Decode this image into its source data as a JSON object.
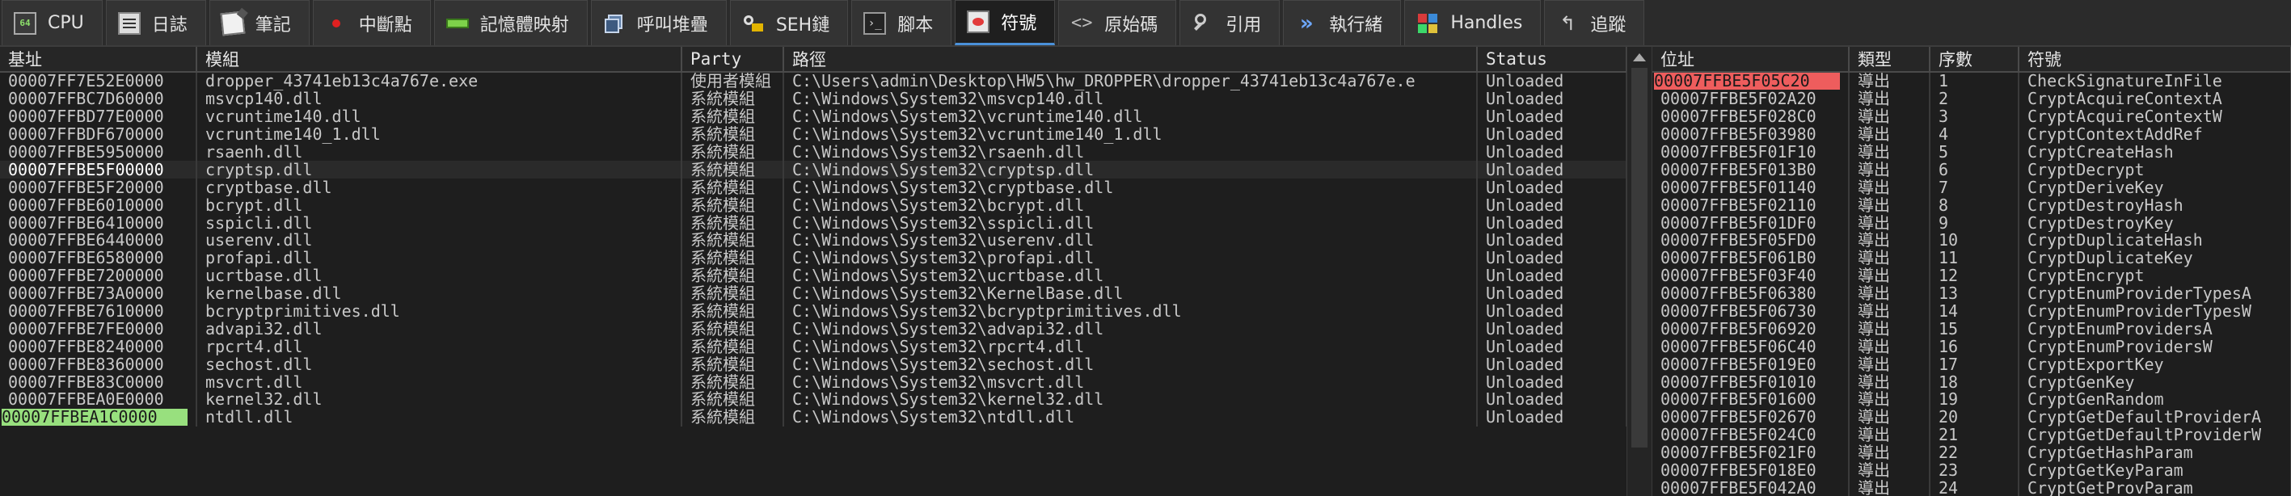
{
  "tabs": [
    {
      "label": "CPU",
      "icon": "cpu-icon"
    },
    {
      "label": "日誌",
      "icon": "log-icon"
    },
    {
      "label": "筆記",
      "icon": "notes-icon"
    },
    {
      "label": "中斷點",
      "icon": "breakpoint-icon"
    },
    {
      "label": "記憶體映射",
      "icon": "memory-map-icon"
    },
    {
      "label": "呼叫堆疊",
      "icon": "call-stack-icon"
    },
    {
      "label": "SEH鏈",
      "icon": "seh-chain-icon"
    },
    {
      "label": "腳本",
      "icon": "script-icon"
    },
    {
      "label": "符號",
      "icon": "symbols-icon",
      "active": true
    },
    {
      "label": "原始碼",
      "icon": "source-icon"
    },
    {
      "label": "引用",
      "icon": "references-icon"
    },
    {
      "label": "執行緒",
      "icon": "threads-icon"
    },
    {
      "label": "Handles",
      "icon": "handles-icon"
    },
    {
      "label": "追蹤",
      "icon": "trace-icon"
    }
  ],
  "modules": {
    "headers": {
      "base": "基址",
      "module": "模組",
      "party": "Party",
      "path": "路徑",
      "status": "Status"
    },
    "rows": [
      {
        "base": "00007FF7E52E0000",
        "module": "dropper_43741eb13c4a767e.exe",
        "party": "使用者模組",
        "path": "C:\\Users\\admin\\Desktop\\HW5\\hw_DROPPER\\dropper_43741eb13c4a767e.e",
        "status": "Unloaded"
      },
      {
        "base": "00007FFBC7D60000",
        "module": "msvcp140.dll",
        "party": "系統模組",
        "path": "C:\\Windows\\System32\\msvcp140.dll",
        "status": "Unloaded"
      },
      {
        "base": "00007FFBD77E0000",
        "module": "vcruntime140.dll",
        "party": "系統模組",
        "path": "C:\\Windows\\System32\\vcruntime140.dll",
        "status": "Unloaded"
      },
      {
        "base": "00007FFBDF670000",
        "module": "vcruntime140_1.dll",
        "party": "系統模組",
        "path": "C:\\Windows\\System32\\vcruntime140_1.dll",
        "status": "Unloaded"
      },
      {
        "base": "00007FFBE5950000",
        "module": "rsaenh.dll",
        "party": "系統模組",
        "path": "C:\\Windows\\System32\\rsaenh.dll",
        "status": "Unloaded"
      },
      {
        "base": "00007FFBE5F00000",
        "module": "cryptsp.dll",
        "party": "系統模組",
        "path": "C:\\Windows\\System32\\cryptsp.dll",
        "status": "Unloaded",
        "selected": true
      },
      {
        "base": "00007FFBE5F20000",
        "module": "cryptbase.dll",
        "party": "系統模組",
        "path": "C:\\Windows\\System32\\cryptbase.dll",
        "status": "Unloaded"
      },
      {
        "base": "00007FFBE6010000",
        "module": "bcrypt.dll",
        "party": "系統模組",
        "path": "C:\\Windows\\System32\\bcrypt.dll",
        "status": "Unloaded"
      },
      {
        "base": "00007FFBE6410000",
        "module": "sspicli.dll",
        "party": "系統模組",
        "path": "C:\\Windows\\System32\\sspicli.dll",
        "status": "Unloaded"
      },
      {
        "base": "00007FFBE6440000",
        "module": "userenv.dll",
        "party": "系統模組",
        "path": "C:\\Windows\\System32\\userenv.dll",
        "status": "Unloaded"
      },
      {
        "base": "00007FFBE6580000",
        "module": "profapi.dll",
        "party": "系統模組",
        "path": "C:\\Windows\\System32\\profapi.dll",
        "status": "Unloaded"
      },
      {
        "base": "00007FFBE7200000",
        "module": "ucrtbase.dll",
        "party": "系統模組",
        "path": "C:\\Windows\\System32\\ucrtbase.dll",
        "status": "Unloaded"
      },
      {
        "base": "00007FFBE73A0000",
        "module": "kernelbase.dll",
        "party": "系統模組",
        "path": "C:\\Windows\\System32\\KernelBase.dll",
        "status": "Unloaded"
      },
      {
        "base": "00007FFBE7610000",
        "module": "bcryptprimitives.dll",
        "party": "系統模組",
        "path": "C:\\Windows\\System32\\bcryptprimitives.dll",
        "status": "Unloaded"
      },
      {
        "base": "00007FFBE7FE0000",
        "module": "advapi32.dll",
        "party": "系統模組",
        "path": "C:\\Windows\\System32\\advapi32.dll",
        "status": "Unloaded"
      },
      {
        "base": "00007FFBE8240000",
        "module": "rpcrt4.dll",
        "party": "系統模組",
        "path": "C:\\Windows\\System32\\rpcrt4.dll",
        "status": "Unloaded"
      },
      {
        "base": "00007FFBE8360000",
        "module": "sechost.dll",
        "party": "系統模組",
        "path": "C:\\Windows\\System32\\sechost.dll",
        "status": "Unloaded"
      },
      {
        "base": "00007FFBE83C0000",
        "module": "msvcrt.dll",
        "party": "系統模組",
        "path": "C:\\Windows\\System32\\msvcrt.dll",
        "status": "Unloaded"
      },
      {
        "base": "00007FFBEA0E0000",
        "module": "kernel32.dll",
        "party": "系統模組",
        "path": "C:\\Windows\\System32\\kernel32.dll",
        "status": "Unloaded"
      },
      {
        "base": "00007FFBEA1C0000",
        "module": "ntdll.dll",
        "party": "系統模組",
        "path": "C:\\Windows\\System32\\ntdll.dll",
        "status": "Unloaded",
        "highlight": true
      }
    ]
  },
  "symbols": {
    "headers": {
      "address": "位址",
      "type": "類型",
      "ordinal": "序數",
      "symbol": "符號"
    },
    "rows": [
      {
        "address": "00007FFBE5F05C20",
        "type": "導出",
        "ordinal": "1",
        "symbol": "CheckSignatureInFile",
        "highlight": true
      },
      {
        "address": "00007FFBE5F02A20",
        "type": "導出",
        "ordinal": "2",
        "symbol": "CryptAcquireContextA"
      },
      {
        "address": "00007FFBE5F028C0",
        "type": "導出",
        "ordinal": "3",
        "symbol": "CryptAcquireContextW"
      },
      {
        "address": "00007FFBE5F03980",
        "type": "導出",
        "ordinal": "4",
        "symbol": "CryptContextAddRef"
      },
      {
        "address": "00007FFBE5F01F10",
        "type": "導出",
        "ordinal": "5",
        "symbol": "CryptCreateHash"
      },
      {
        "address": "00007FFBE5F013B0",
        "type": "導出",
        "ordinal": "6",
        "symbol": "CryptDecrypt"
      },
      {
        "address": "00007FFBE5F01140",
        "type": "導出",
        "ordinal": "7",
        "symbol": "CryptDeriveKey"
      },
      {
        "address": "00007FFBE5F02110",
        "type": "導出",
        "ordinal": "8",
        "symbol": "CryptDestroyHash"
      },
      {
        "address": "00007FFBE5F01DF0",
        "type": "導出",
        "ordinal": "9",
        "symbol": "CryptDestroyKey"
      },
      {
        "address": "00007FFBE5F05FD0",
        "type": "導出",
        "ordinal": "10",
        "symbol": "CryptDuplicateHash"
      },
      {
        "address": "00007FFBE5F061B0",
        "type": "導出",
        "ordinal": "11",
        "symbol": "CryptDuplicateKey"
      },
      {
        "address": "00007FFBE5F03F40",
        "type": "導出",
        "ordinal": "12",
        "symbol": "CryptEncrypt"
      },
      {
        "address": "00007FFBE5F06380",
        "type": "導出",
        "ordinal": "13",
        "symbol": "CryptEnumProviderTypesA"
      },
      {
        "address": "00007FFBE5F06730",
        "type": "導出",
        "ordinal": "14",
        "symbol": "CryptEnumProviderTypesW"
      },
      {
        "address": "00007FFBE5F06920",
        "type": "導出",
        "ordinal": "15",
        "symbol": "CryptEnumProvidersA"
      },
      {
        "address": "00007FFBE5F06C40",
        "type": "導出",
        "ordinal": "16",
        "symbol": "CryptEnumProvidersW"
      },
      {
        "address": "00007FFBE5F019E0",
        "type": "導出",
        "ordinal": "17",
        "symbol": "CryptExportKey"
      },
      {
        "address": "00007FFBE5F01010",
        "type": "導出",
        "ordinal": "18",
        "symbol": "CryptGenKey"
      },
      {
        "address": "00007FFBE5F01600",
        "type": "導出",
        "ordinal": "19",
        "symbol": "CryptGenRandom"
      },
      {
        "address": "00007FFBE5F02670",
        "type": "導出",
        "ordinal": "20",
        "symbol": "CryptGetDefaultProviderA"
      },
      {
        "address": "00007FFBE5F024C0",
        "type": "導出",
        "ordinal": "21",
        "symbol": "CryptGetDefaultProviderW"
      },
      {
        "address": "00007FFBE5F021F0",
        "type": "導出",
        "ordinal": "22",
        "symbol": "CryptGetHashParam"
      },
      {
        "address": "00007FFBE5F018E0",
        "type": "導出",
        "ordinal": "23",
        "symbol": "CryptGetKeyParam"
      },
      {
        "address": "00007FFBE5F042A0",
        "type": "導出",
        "ordinal": "24",
        "symbol": "CryptGetProvParam"
      }
    ]
  },
  "colors": {
    "accent": "#4a90d9",
    "highlight_green": "#98e07e",
    "highlight_red": "#ee5d5d",
    "background": "#1e1e1e"
  }
}
